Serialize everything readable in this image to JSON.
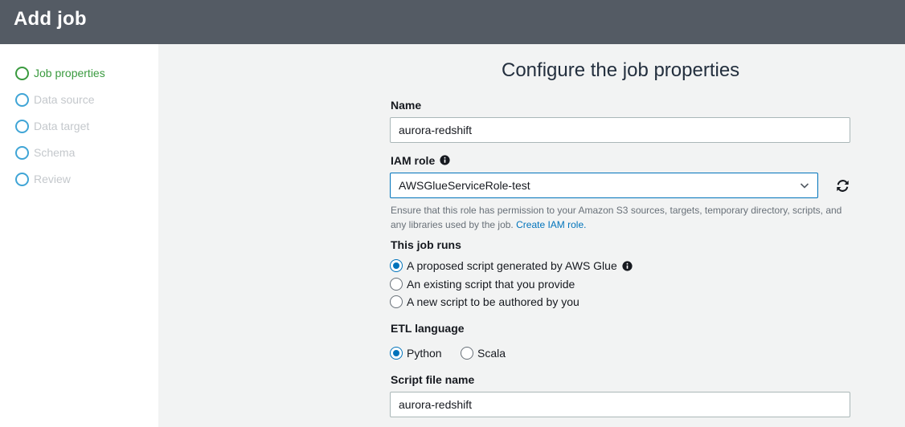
{
  "header": {
    "title": "Add job"
  },
  "sidebar": {
    "steps": [
      {
        "label": "Job properties",
        "state": "active"
      },
      {
        "label": "Data source",
        "state": "pending"
      },
      {
        "label": "Data target",
        "state": "pending"
      },
      {
        "label": "Schema",
        "state": "pending"
      },
      {
        "label": "Review",
        "state": "pending"
      }
    ]
  },
  "form": {
    "title": "Configure the job properties",
    "name": {
      "label": "Name",
      "value": "aurora-redshift"
    },
    "iam_role": {
      "label": "IAM role",
      "value": "AWSGlueServiceRole-test",
      "help_text": "Ensure that this role has permission to your Amazon S3 sources, targets, temporary directory, scripts, and any libraries used by the job.",
      "help_link": "Create IAM role."
    },
    "job_runs": {
      "label": "This job runs",
      "options": [
        {
          "label": "A proposed script generated by AWS Glue",
          "selected": true
        },
        {
          "label": "An existing script that you provide",
          "selected": false
        },
        {
          "label": "A new script to be authored by you",
          "selected": false
        }
      ]
    },
    "etl_language": {
      "label": "ETL language",
      "options": [
        {
          "label": "Python",
          "selected": true
        },
        {
          "label": "Scala",
          "selected": false
        }
      ]
    },
    "script_file_name": {
      "label": "Script file name",
      "value": "aurora-redshift"
    }
  },
  "colors": {
    "header_bg": "#545b64",
    "active_step": "#3a9a3f",
    "pending_step_circle": "#40a5d6",
    "link": "#0073bb"
  },
  "icons": {
    "info": "info-icon",
    "refresh": "refresh-icon",
    "chevron": "chevron-down-icon"
  }
}
